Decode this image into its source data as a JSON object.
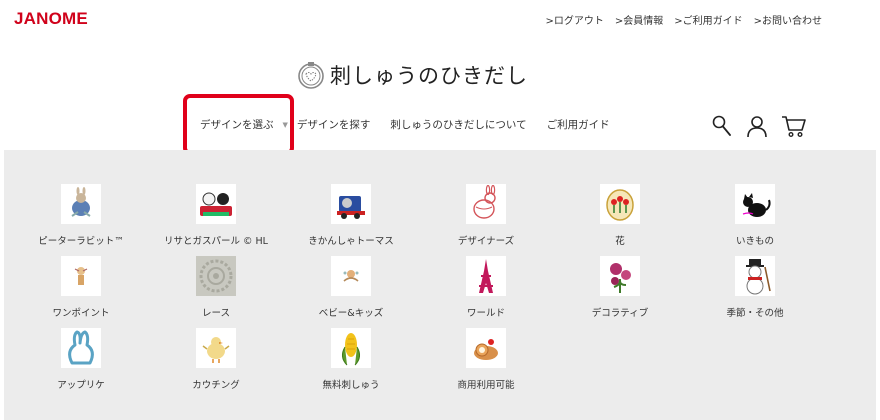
{
  "brand": {
    "name": "JANOME",
    "color": "#d0021b"
  },
  "top_links": [
    {
      "label": ">ログアウト"
    },
    {
      "label": ">会員情報"
    },
    {
      "label": ">ご利用ガイド"
    },
    {
      "label": ">お問い合わせ"
    }
  ],
  "site": {
    "title": "刺しゅうのひきだし"
  },
  "nav": {
    "items": [
      {
        "label": "デザインを選ぶ",
        "has_dropdown": true,
        "highlighted": true
      },
      {
        "label": "デザインを探す"
      },
      {
        "label": "刺しゅうのひきだしについて"
      },
      {
        "label": "ご利用ガイド"
      }
    ],
    "highlight_color": "#e0001a"
  },
  "header_icons": [
    "search-icon",
    "user-icon",
    "cart-icon"
  ],
  "categories": [
    {
      "label": "ピーターラビット™",
      "icon": "peter-rabbit-icon"
    },
    {
      "label": "リサとガスパール © HL",
      "icon": "lisa-gaspard-icon"
    },
    {
      "label": "きかんしゃトーマス",
      "icon": "thomas-train-icon"
    },
    {
      "label": "デザイナーズ",
      "icon": "designer-rabbits-icon"
    },
    {
      "label": "花",
      "icon": "flower-icon"
    },
    {
      "label": "いきもの",
      "icon": "cat-icon"
    },
    {
      "label": "ワンポイント",
      "icon": "one-point-icon"
    },
    {
      "label": "レース",
      "icon": "lace-icon"
    },
    {
      "label": "ベビー&キッズ",
      "icon": "baby-kids-icon"
    },
    {
      "label": "ワールド",
      "icon": "eiffel-tower-icon"
    },
    {
      "label": "デコラティブ",
      "icon": "decorative-rose-icon"
    },
    {
      "label": "季節・その他",
      "icon": "snowman-icon"
    },
    {
      "label": "アップリケ",
      "icon": "applique-rabbit-icon"
    },
    {
      "label": "カウチング",
      "icon": "chick-icon"
    },
    {
      "label": "無料刺しゅう",
      "icon": "corn-icon"
    },
    {
      "label": "商用利用可能",
      "icon": "roll-cake-icon"
    }
  ],
  "colors": {
    "panel": "#ececec",
    "accent": "#d0021b"
  }
}
